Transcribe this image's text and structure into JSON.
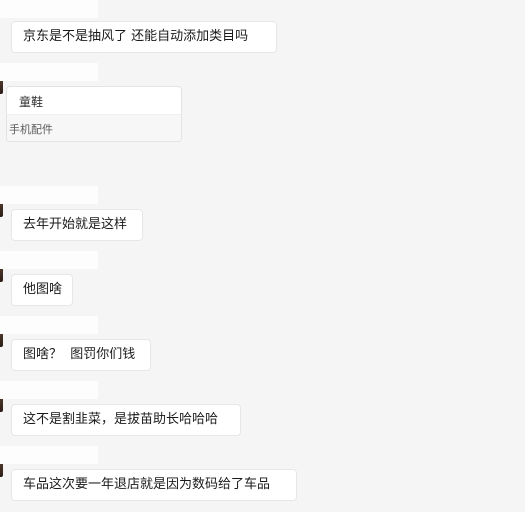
{
  "messages": [
    {
      "type": "text",
      "text": "京东是不是抽风了 还能自动添加类目吗"
    },
    {
      "type": "card",
      "title": "童鞋",
      "subtitle": "手机配件"
    },
    {
      "type": "text",
      "text": "去年开始就是这样"
    },
    {
      "type": "text",
      "text": "他图啥"
    },
    {
      "type": "text",
      "text": "图啥？  图罚你们钱"
    },
    {
      "type": "text",
      "text": "这不是割韭菜，是拔苗助长哈哈哈"
    },
    {
      "type": "text",
      "text": "车品这次要一年退店就是因为数码给了车品"
    }
  ],
  "colors": {
    "background": "#f5f5f5",
    "bubble": "#ffffff",
    "bubble_border": "#e7e7e7",
    "text": "#1a1a1a"
  }
}
